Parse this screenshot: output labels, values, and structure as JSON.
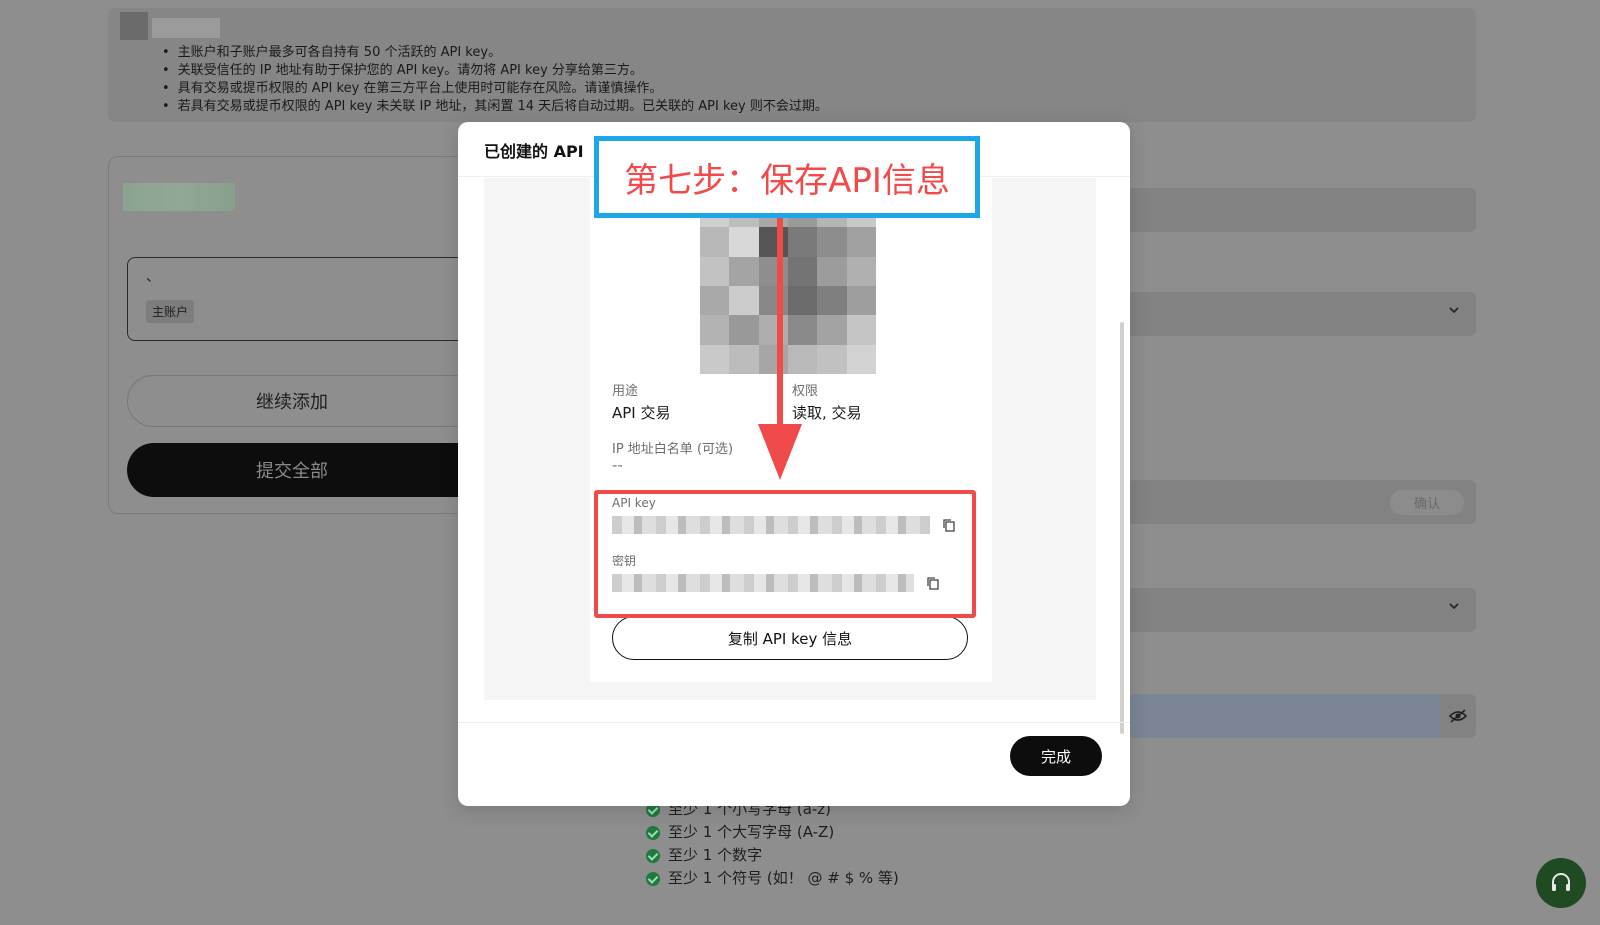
{
  "background": {
    "notices": [
      "主账户和子账户最多可各自持有 50 个活跃的 API key。",
      "关联受信任的 IP 地址有助于保护您的 API key。请勿将 API key 分享给第三方。",
      "具有交易或提币权限的 API key 在第三方平台上使用时可能存在风险。请谨慎操作。",
      "若具有交易或提币权限的 API key 未关联 IP 地址，其闲置 14 天后将自动过期。已关联的 API key 则不会过期。"
    ],
    "account_mark": "、",
    "account_tag": "主账户",
    "continue_label": "继续添加",
    "submit_label": "提交全部",
    "confirm_label": "确认",
    "password_rules": [
      "至少 1 个小写字母 (a-z)",
      "至少 1 个大写字母 (A-Z)",
      "至少 1 个数字",
      "至少 1 个符号 (如！ @ # $ % 等)"
    ]
  },
  "modal": {
    "title": "已创建的 API",
    "usage_label": "用途",
    "usage_value": "API 交易",
    "permission_label": "权限",
    "permission_value": "读取, 交易",
    "ip_label": "IP 地址白名单 (可选)",
    "ip_value": "--",
    "api_key_label": "API key",
    "secret_label": "密钥",
    "copy_button": "复制 API key 信息",
    "done_button": "完成"
  },
  "annotation": {
    "step_text": "第七步：保存API信息",
    "label_border_color": "#1ea7e8",
    "highlight_color": "#f04a4a"
  },
  "icons": [
    "copy-icon",
    "chevron-down-icon",
    "eye-off-icon",
    "check-circle-icon",
    "headset-icon"
  ]
}
